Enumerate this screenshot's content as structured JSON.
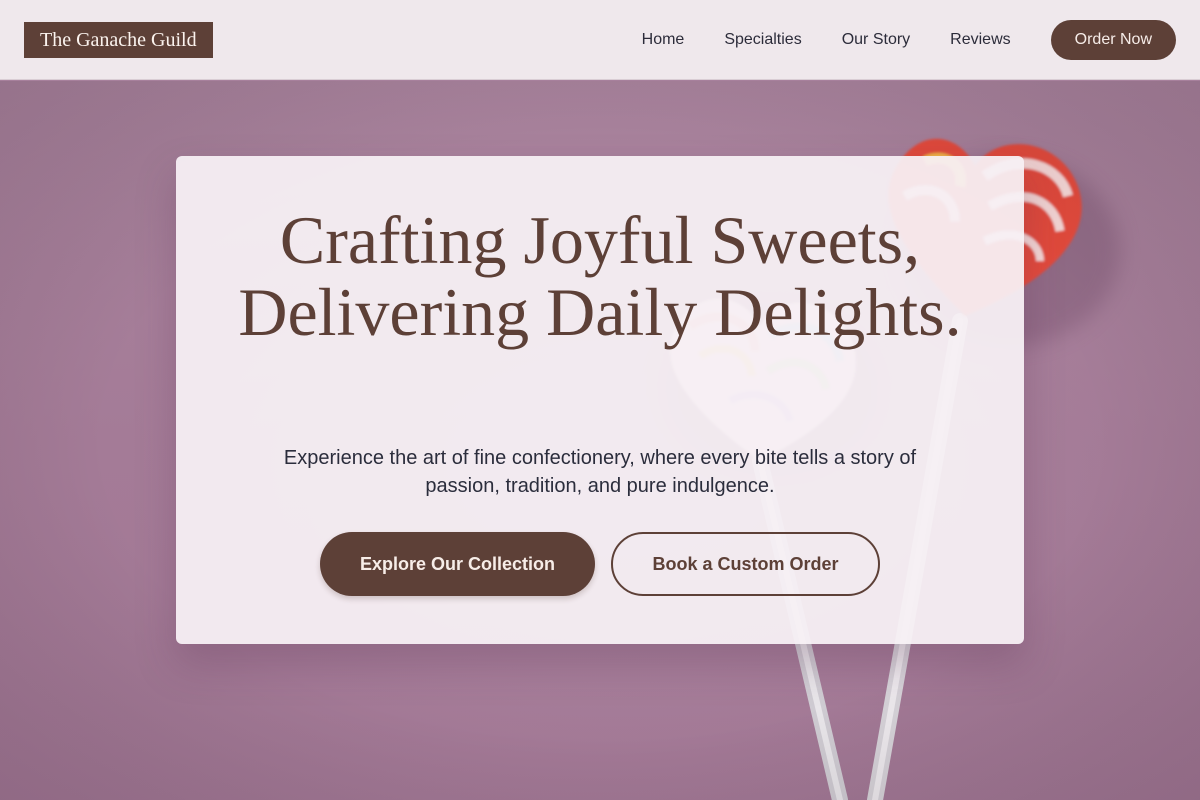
{
  "header": {
    "logo_text": "The Ganache Guild",
    "nav": [
      {
        "label": "Home"
      },
      {
        "label": "Specialties"
      },
      {
        "label": "Our Story"
      },
      {
        "label": "Reviews"
      }
    ],
    "cta_label": "Order Now"
  },
  "hero": {
    "title": "Crafting Joyful Sweets, Delivering Daily Delights.",
    "subtitle": "Experience the art of fine confectionery, where every bite tells a story of passion, tradition, and pure indulgence.",
    "primary_button": "Explore Our Collection",
    "secondary_button": "Book a Custom Order"
  },
  "colors": {
    "brand_brown": "#5d4037",
    "header_bg": "#efe8ec",
    "hero_bg": "#a7809c",
    "card_bg": "#f7f0f4"
  }
}
